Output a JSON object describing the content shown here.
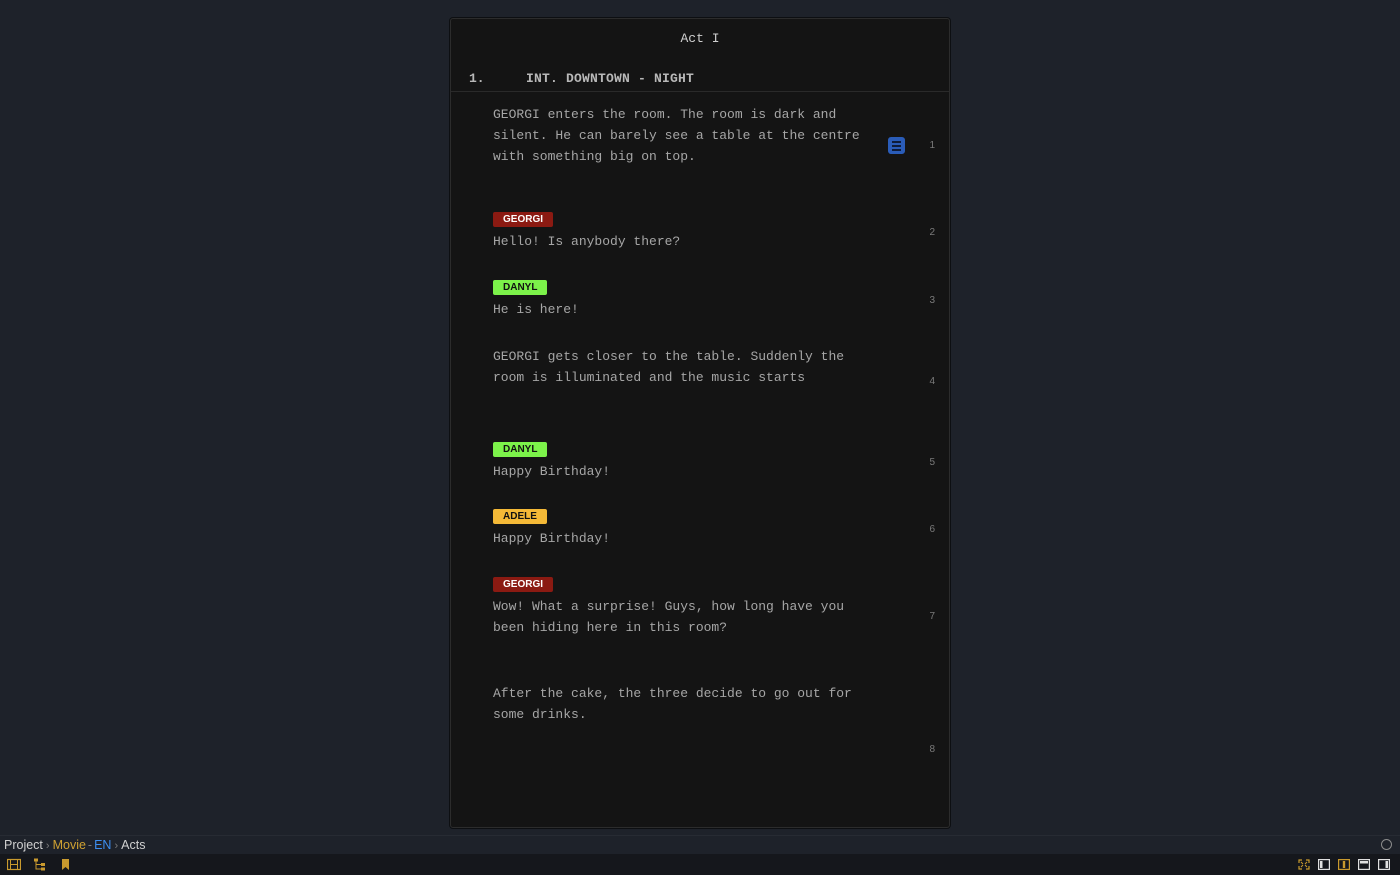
{
  "page": {
    "act_title": "Act I",
    "scene": {
      "number": "1.",
      "heading": "INT. DOWNTOWN - NIGHT"
    },
    "blocks": [
      {
        "type": "action",
        "line": "1",
        "text": "GEORGI enters the room. The room is dark and silent. He can barely see a table at the centre with something big on top."
      },
      {
        "type": "dialogue",
        "line": "2",
        "character": "GEORGI",
        "text": "Hello! Is anybody there?"
      },
      {
        "type": "dialogue",
        "line": "3",
        "character": "DANYL",
        "text": "He is here!"
      },
      {
        "type": "action",
        "line": "4",
        "text": "GEORGI gets closer to the table. Suddenly the room is illuminated and the music starts"
      },
      {
        "type": "dialogue",
        "line": "5",
        "character": "DANYL",
        "text": "Happy Birthday!"
      },
      {
        "type": "dialogue",
        "line": "6",
        "character": "ADELE",
        "text": "Happy Birthday!"
      },
      {
        "type": "dialogue",
        "line": "7",
        "character": "GEORGI",
        "text": "Wow! What a surprise! Guys, how long have you been hiding here in this room?"
      },
      {
        "type": "action",
        "line": "8",
        "text": "After the cake, the three decide to go out for some drinks."
      }
    ],
    "characters": {
      "GEORGI": {
        "bg": "#8b1a12",
        "fg": "#ffffff"
      },
      "DANYL": {
        "bg": "#7cf24a",
        "fg": "#111111"
      },
      "ADELE": {
        "bg": "#f4b937",
        "fg": "#111111"
      }
    },
    "note_icon": "note-icon"
  },
  "breadcrumb": {
    "project": "Project",
    "movie": "Movie",
    "lang": "EN",
    "section": "Acts",
    "separator": "›",
    "dash": "-"
  },
  "status_bar": {
    "left_icons": [
      "film-icon",
      "hierarchy-icon",
      "bookmark-icon"
    ],
    "right_icons": [
      "fullscreen-icon",
      "left-panel-icon",
      "center-panel-icon",
      "top-panel-icon",
      "right-panel-icon"
    ]
  },
  "colors": {
    "background": "#1e222a",
    "page": "#141414",
    "accent_gold": "#d0a232",
    "accent_blue": "#3c8ef0"
  }
}
